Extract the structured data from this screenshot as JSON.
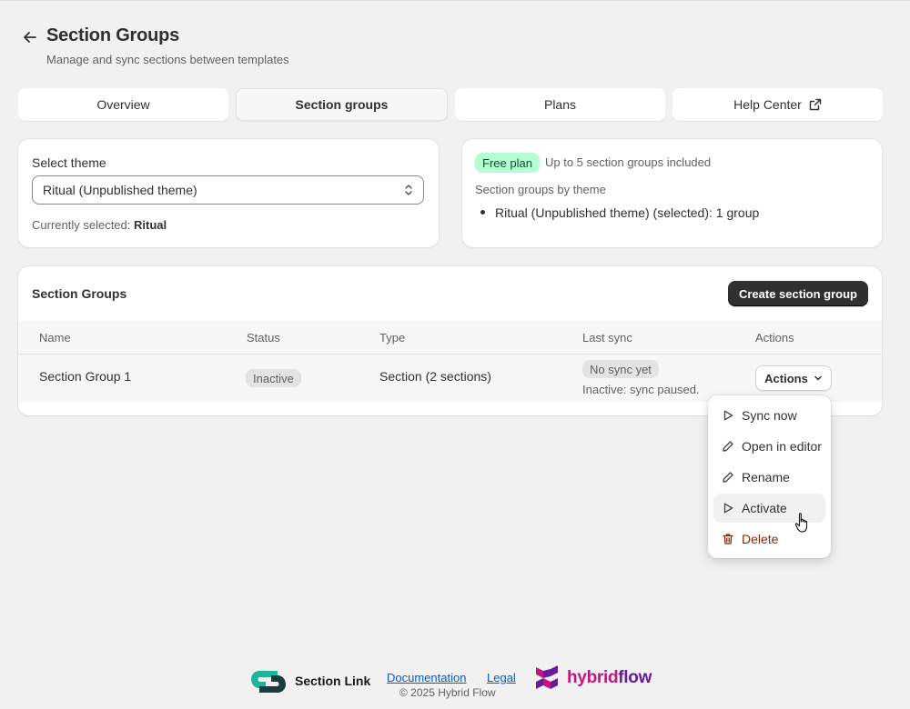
{
  "header": {
    "title": "Section Groups",
    "subtitle": "Manage and sync sections between templates"
  },
  "tabs": [
    {
      "label": "Overview",
      "active": false
    },
    {
      "label": "Section groups",
      "active": true
    },
    {
      "label": "Plans",
      "active": false
    },
    {
      "label": "Help Center",
      "active": false,
      "icon": "external-link-icon"
    }
  ],
  "theme_card": {
    "label": "Select theme",
    "selected_value": "Ritual (Unpublished theme)",
    "current_prefix": "Currently selected:",
    "current_value": "Ritual"
  },
  "plan_card": {
    "badge": "Free plan",
    "limit_text": "Up to 5 section groups included",
    "by_theme_label": "Section groups by theme",
    "theme_items": [
      "Ritual (Unpublished theme) (selected): 1 group"
    ]
  },
  "groups": {
    "title": "Section Groups",
    "create_label": "Create section group",
    "columns": [
      "Name",
      "Status",
      "Type",
      "Last sync",
      "Actions"
    ],
    "rows": [
      {
        "name": "Section Group 1",
        "status": "Inactive",
        "type": "Section (2 sections)",
        "last_sync": "No sync yet",
        "sync_note": "Inactive: sync paused.",
        "actions_label": "Actions"
      }
    ]
  },
  "actions_menu": {
    "items": [
      {
        "label": "Sync now",
        "icon": "play-icon"
      },
      {
        "label": "Open in editor",
        "icon": "pencil-icon"
      },
      {
        "label": "Rename",
        "icon": "pencil-icon"
      },
      {
        "label": "Activate",
        "icon": "play-icon"
      },
      {
        "label": "Delete",
        "icon": "trash-icon"
      }
    ],
    "hovered": "Activate"
  },
  "footer": {
    "brand": "Section Link",
    "documentation": "Documentation",
    "legal": "Legal",
    "copyright": "© 2025 Hybrid Flow",
    "partner_a": "hybrid",
    "partner_b": "flow"
  },
  "colors": {
    "background": "#f1f1f1",
    "primary_button": "#303030",
    "free_badge": "#b4fed2",
    "link": "#005bd3",
    "danger": "#8e1f0b",
    "hybrid": "#c2167f",
    "flow": "#6a1b9a"
  }
}
